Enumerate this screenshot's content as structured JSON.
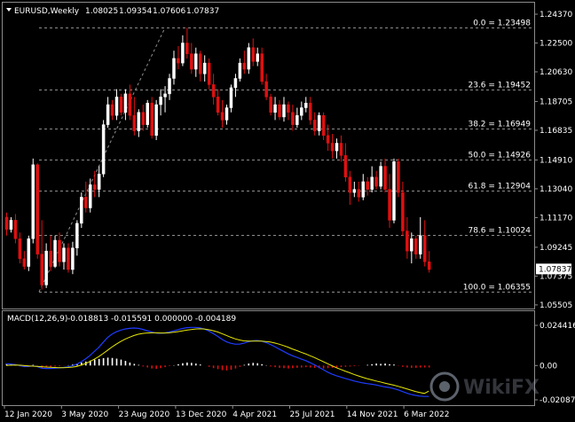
{
  "colors": {
    "background": "#000000",
    "bull": "#ffffff",
    "bear": "#e01010",
    "grid": "#8c8c8c",
    "macd_line": "#1e3cff",
    "signal_line": "#e8e800",
    "histogram_pos": "#ffffff",
    "histogram_neg": "#e01010",
    "price_box": "#ffffff"
  },
  "header": {
    "symbol": "EURUSD,Weekly",
    "open": "1.08025",
    "high": "1.09354",
    "low": "1.07606",
    "close": "1.07837"
  },
  "macd_header": {
    "name": "MACD(12,26,9)",
    "values": "-0.018813 -0.015591 0.000000 -0.004189"
  },
  "price_axis_labels": [
    "1.24370",
    "1.22500",
    "1.20630",
    "1.18705",
    "1.16835",
    "1.14910",
    "1.13040",
    "1.11170",
    "1.09245",
    "1.07375",
    "1.05505"
  ],
  "current_price": "1.07837",
  "macd_axis_labels": [
    "0.024416",
    "0.00",
    "-0.020873"
  ],
  "time_axis_labels": [
    "12 Jan 2020",
    "3 May 2020",
    "23 Aug 2020",
    "13 Dec 2020",
    "4 Apr 2021",
    "25 Jul 2021",
    "14 Nov 2021",
    "6 Mar 2022"
  ],
  "fib_levels": [
    {
      "label": "0.0 = 1.23498",
      "value": 1.23498
    },
    {
      "label": "23.6 = 1.19452",
      "value": 1.19452
    },
    {
      "label": "38.2 = 1.16949",
      "value": 1.16949
    },
    {
      "label": "50.0 = 1.14926",
      "value": 1.14926
    },
    {
      "label": "61.8 = 1.12904",
      "value": 1.12904
    },
    {
      "label": "78.6 = 1.10024",
      "value": 1.10024
    },
    {
      "label": "100.0 = 1.06355",
      "value": 1.06355
    }
  ],
  "watermark": "WikiFX",
  "chart_data": {
    "type": "candlestick",
    "ylim": [
      1.055,
      1.2437
    ],
    "macd_ylim": [
      -0.020873,
      0.024416
    ],
    "series": [
      {
        "name": "EURUSD,Weekly",
        "values": [
          [
            1.112,
            1.115,
            1.1,
            1.104
          ],
          [
            1.104,
            1.112,
            1.102,
            1.11
          ],
          [
            1.11,
            1.114,
            1.095,
            1.098
          ],
          [
            1.098,
            1.102,
            1.082,
            1.085
          ],
          [
            1.085,
            1.09,
            1.078,
            1.08
          ],
          [
            1.08,
            1.1,
            1.077,
            1.098
          ],
          [
            1.098,
            1.15,
            1.095,
            1.146
          ],
          [
            1.146,
            1.147,
            1.085,
            1.088
          ],
          [
            1.088,
            1.11,
            1.065,
            1.068
          ],
          [
            1.068,
            1.095,
            1.066,
            1.09
          ],
          [
            1.09,
            1.1,
            1.077,
            1.08
          ],
          [
            1.08,
            1.1,
            1.079,
            1.097
          ],
          [
            1.097,
            1.102,
            1.08,
            1.083
          ],
          [
            1.083,
            1.095,
            1.078,
            1.092
          ],
          [
            1.092,
            1.095,
            1.076,
            1.078
          ],
          [
            1.078,
            1.096,
            1.075,
            1.092
          ],
          [
            1.092,
            1.11,
            1.087,
            1.108
          ],
          [
            1.108,
            1.128,
            1.105,
            1.125
          ],
          [
            1.125,
            1.135,
            1.115,
            1.118
          ],
          [
            1.118,
            1.137,
            1.115,
            1.133
          ],
          [
            1.133,
            1.142,
            1.125,
            1.13
          ],
          [
            1.13,
            1.145,
            1.125,
            1.14
          ],
          [
            1.14,
            1.175,
            1.138,
            1.172
          ],
          [
            1.172,
            1.19,
            1.17,
            1.185
          ],
          [
            1.185,
            1.188,
            1.175,
            1.178
          ],
          [
            1.178,
            1.195,
            1.175,
            1.19
          ],
          [
            1.19,
            1.192,
            1.178,
            1.18
          ],
          [
            1.18,
            1.195,
            1.175,
            1.192
          ],
          [
            1.192,
            1.198,
            1.175,
            1.178
          ],
          [
            1.178,
            1.19,
            1.165,
            1.168
          ],
          [
            1.168,
            1.182,
            1.164,
            1.18
          ],
          [
            1.18,
            1.185,
            1.168,
            1.172
          ],
          [
            1.172,
            1.188,
            1.17,
            1.186
          ],
          [
            1.186,
            1.19,
            1.163,
            1.165
          ],
          [
            1.165,
            1.188,
            1.162,
            1.185
          ],
          [
            1.185,
            1.195,
            1.178,
            1.19
          ],
          [
            1.19,
            1.197,
            1.18,
            1.192
          ],
          [
            1.192,
            1.205,
            1.188,
            1.202
          ],
          [
            1.202,
            1.22,
            1.198,
            1.215
          ],
          [
            1.215,
            1.223,
            1.208,
            1.212
          ],
          [
            1.212,
            1.23,
            1.21,
            1.225
          ],
          [
            1.225,
            1.235,
            1.215,
            1.218
          ],
          [
            1.218,
            1.225,
            1.205,
            1.208
          ],
          [
            1.208,
            1.222,
            1.203,
            1.218
          ],
          [
            1.218,
            1.22,
            1.2,
            1.205
          ],
          [
            1.205,
            1.217,
            1.2,
            1.212
          ],
          [
            1.212,
            1.215,
            1.195,
            1.198
          ],
          [
            1.198,
            1.205,
            1.185,
            1.19
          ],
          [
            1.19,
            1.195,
            1.178,
            1.18
          ],
          [
            1.18,
            1.188,
            1.17,
            1.175
          ],
          [
            1.175,
            1.185,
            1.172,
            1.183
          ],
          [
            1.183,
            1.198,
            1.18,
            1.196
          ],
          [
            1.196,
            1.205,
            1.19,
            1.202
          ],
          [
            1.202,
            1.215,
            1.2,
            1.212
          ],
          [
            1.212,
            1.22,
            1.205,
            1.208
          ],
          [
            1.208,
            1.225,
            1.205,
            1.222
          ],
          [
            1.222,
            1.228,
            1.21,
            1.213
          ],
          [
            1.213,
            1.222,
            1.21,
            1.218
          ],
          [
            1.218,
            1.222,
            1.198,
            1.2
          ],
          [
            1.2,
            1.205,
            1.188,
            1.19
          ],
          [
            1.19,
            1.192,
            1.178,
            1.18
          ],
          [
            1.18,
            1.19,
            1.175,
            1.185
          ],
          [
            1.185,
            1.188,
            1.175,
            1.177
          ],
          [
            1.177,
            1.19,
            1.174,
            1.185
          ],
          [
            1.185,
            1.187,
            1.175,
            1.18
          ],
          [
            1.18,
            1.185,
            1.168,
            1.172
          ],
          [
            1.172,
            1.183,
            1.17,
            1.178
          ],
          [
            1.178,
            1.187,
            1.175,
            1.183
          ],
          [
            1.183,
            1.19,
            1.18,
            1.186
          ],
          [
            1.186,
            1.19,
            1.172,
            1.175
          ],
          [
            1.175,
            1.18,
            1.165,
            1.168
          ],
          [
            1.168,
            1.18,
            1.165,
            1.178
          ],
          [
            1.178,
            1.18,
            1.162,
            1.165
          ],
          [
            1.165,
            1.172,
            1.155,
            1.16
          ],
          [
            1.16,
            1.166,
            1.15,
            1.155
          ],
          [
            1.155,
            1.163,
            1.15,
            1.16
          ],
          [
            1.16,
            1.165,
            1.148,
            1.152
          ],
          [
            1.152,
            1.16,
            1.135,
            1.138
          ],
          [
            1.138,
            1.142,
            1.12,
            1.128
          ],
          [
            1.128,
            1.135,
            1.125,
            1.13
          ],
          [
            1.13,
            1.135,
            1.122,
            1.125
          ],
          [
            1.125,
            1.14,
            1.123,
            1.135
          ],
          [
            1.135,
            1.138,
            1.126,
            1.13
          ],
          [
            1.13,
            1.145,
            1.128,
            1.138
          ],
          [
            1.138,
            1.142,
            1.13,
            1.132
          ],
          [
            1.132,
            1.148,
            1.13,
            1.145
          ],
          [
            1.145,
            1.15,
            1.128,
            1.13
          ],
          [
            1.13,
            1.14,
            1.105,
            1.11
          ],
          [
            1.11,
            1.15,
            1.108,
            1.148
          ],
          [
            1.148,
            1.15,
            1.125,
            1.128
          ],
          [
            1.128,
            1.135,
            1.1,
            1.103
          ],
          [
            1.103,
            1.112,
            1.085,
            1.09
          ],
          [
            1.09,
            1.102,
            1.082,
            1.098
          ],
          [
            1.098,
            1.1,
            1.085,
            1.088
          ],
          [
            1.088,
            1.112,
            1.085,
            1.1
          ],
          [
            1.1,
            1.11,
            1.08,
            1.083
          ],
          [
            1.083,
            1.09,
            1.076,
            1.078
          ]
        ]
      }
    ],
    "macd": {
      "histogram": [
        0.0012,
        0.0008,
        0.0003,
        -0.0005,
        -0.001,
        -0.0008,
        0.0004,
        -0.0002,
        -0.0015,
        -0.0012,
        -0.001,
        -0.0006,
        -0.0004,
        -0.0001,
        0.0002,
        0.0006,
        0.0012,
        0.0018,
        0.0024,
        0.003,
        0.0036,
        0.004,
        0.0045,
        0.0048,
        0.0046,
        0.0042,
        0.0036,
        0.0028,
        0.0018,
        0.001,
        0.0004,
        -0.0006,
        -0.0012,
        -0.0018,
        -0.002,
        -0.0016,
        -0.001,
        -0.0004,
        0.0002,
        0.0008,
        0.0014,
        0.0018,
        0.0016,
        0.0012,
        0.0006,
        0.0,
        -0.0008,
        -0.0016,
        -0.0022,
        -0.0028,
        -0.003,
        -0.0026,
        -0.0018,
        -0.0008,
        0.0004,
        0.0012,
        0.0016,
        0.0014,
        0.0008,
        0.0002,
        -0.0006,
        -0.001,
        -0.0014,
        -0.0016,
        -0.0018,
        -0.0016,
        -0.0014,
        -0.0012,
        -0.001,
        -0.0012,
        -0.0014,
        -0.0016,
        -0.0018,
        -0.0016,
        -0.0014,
        -0.0012,
        -0.001,
        -0.0008,
        -0.0006,
        -0.0004,
        -0.0002,
        0.0,
        0.0004,
        0.0008,
        0.0012,
        0.001,
        0.0012,
        0.0008,
        0.0006,
        -0.0002,
        -0.0008,
        -0.0012,
        -0.0014,
        -0.0014,
        -0.0012,
        -0.0012,
        -0.0012
      ],
      "macd": [
        0.001,
        0.0009,
        0.0006,
        0.0,
        -0.0006,
        -0.0006,
        -0.0002,
        -0.0006,
        -0.0016,
        -0.0018,
        -0.0018,
        -0.0016,
        -0.0014,
        -0.0012,
        -0.0008,
        -0.0002,
        0.0008,
        0.0022,
        0.004,
        0.006,
        0.0085,
        0.011,
        0.014,
        0.017,
        0.019,
        0.0205,
        0.0215,
        0.0222,
        0.0226,
        0.0228,
        0.0226,
        0.022,
        0.0212,
        0.0204,
        0.0198,
        0.0196,
        0.0198,
        0.0203,
        0.021,
        0.0218,
        0.0225,
        0.023,
        0.0232,
        0.0232,
        0.0229,
        0.0222,
        0.021,
        0.0195,
        0.0178,
        0.016,
        0.0145,
        0.0135,
        0.013,
        0.013,
        0.0136,
        0.0144,
        0.015,
        0.0152,
        0.0148,
        0.014,
        0.0128,
        0.0115,
        0.01,
        0.0086,
        0.0072,
        0.006,
        0.005,
        0.004,
        0.003,
        0.0018,
        0.0005,
        -0.001,
        -0.0025,
        -0.004,
        -0.0052,
        -0.0062,
        -0.007,
        -0.0078,
        -0.0086,
        -0.0094,
        -0.01,
        -0.0106,
        -0.011,
        -0.0114,
        -0.0118,
        -0.0124,
        -0.013,
        -0.0134,
        -0.014,
        -0.0148,
        -0.0158,
        -0.0168,
        -0.0176,
        -0.0182,
        -0.0186,
        -0.0188,
        -0.0188
      ],
      "signal": [
        0.0,
        0.0002,
        0.0003,
        0.0002,
        0.0,
        -0.0002,
        -0.0004,
        -0.0005,
        -0.0007,
        -0.0009,
        -0.0011,
        -0.0012,
        -0.0013,
        -0.0013,
        -0.0012,
        -0.001,
        -0.0006,
        0.0002,
        0.0012,
        0.0024,
        0.0038,
        0.0054,
        0.0072,
        0.0092,
        0.0112,
        0.013,
        0.0146,
        0.016,
        0.0172,
        0.0182,
        0.019,
        0.0195,
        0.0198,
        0.0199,
        0.0199,
        0.0198,
        0.0198,
        0.0199,
        0.0202,
        0.0206,
        0.021,
        0.0215,
        0.0219,
        0.0222,
        0.0223,
        0.0222,
        0.0218,
        0.0212,
        0.0204,
        0.0194,
        0.0183,
        0.0172,
        0.0162,
        0.0155,
        0.015,
        0.0148,
        0.0148,
        0.0148,
        0.0148,
        0.0146,
        0.0143,
        0.0137,
        0.013,
        0.0121,
        0.0112,
        0.0101,
        0.0091,
        0.0081,
        0.0071,
        0.006,
        0.0049,
        0.0036,
        0.0024,
        0.0011,
        -0.0001,
        -0.0013,
        -0.0024,
        -0.0034,
        -0.0044,
        -0.0054,
        -0.0063,
        -0.0072,
        -0.008,
        -0.0087,
        -0.0094,
        -0.01,
        -0.0107,
        -0.0113,
        -0.0119,
        -0.0126,
        -0.0134,
        -0.0142,
        -0.015,
        -0.0158,
        -0.0164,
        -0.017,
        -0.0156
      ]
    }
  }
}
